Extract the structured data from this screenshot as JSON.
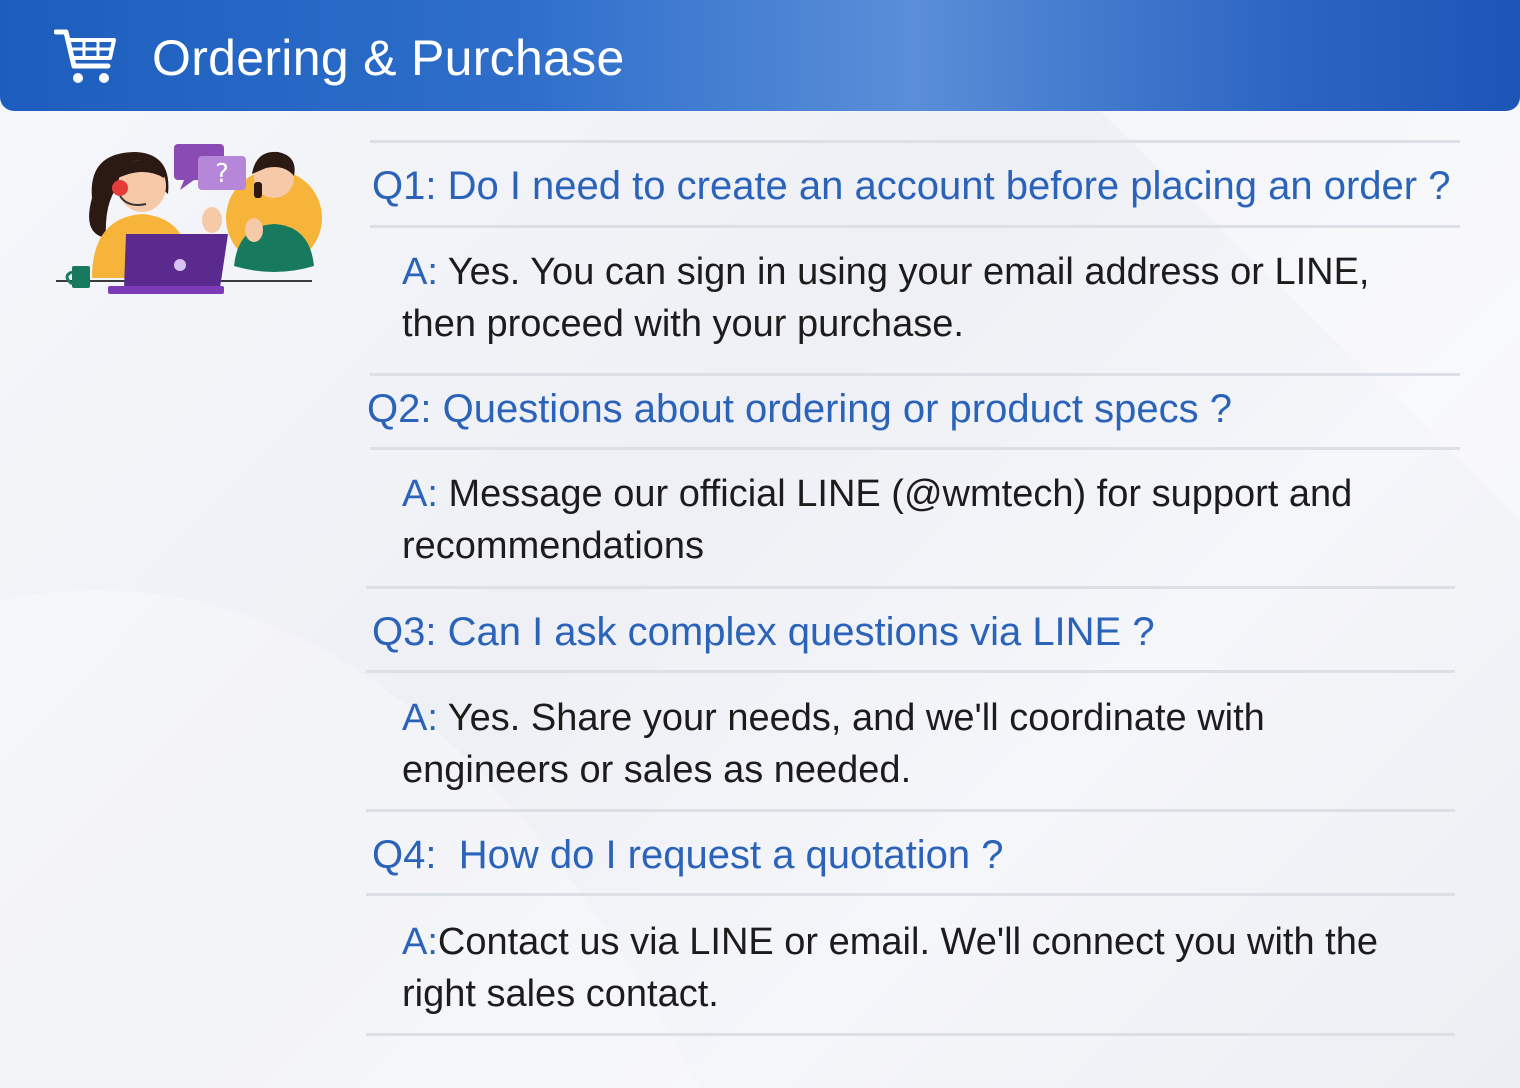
{
  "header": {
    "title": "Ordering & Purchase",
    "icon": "shopping-cart-icon"
  },
  "illustration": {
    "icon": "customer-support-illustration",
    "bubble_glyph": "?"
  },
  "faq": [
    {
      "question": "Q1: Do I need to create an account before placing an order ?",
      "answer_label": "A:",
      "answer_text": " Yes. You can sign in using your email address or LINE, then proceed with your purchase."
    },
    {
      "question": "Q2: Questions about ordering or product specs ?",
      "answer_label": "A:",
      "answer_text": " Message our official LINE (@wmtech) for support and recommendations"
    },
    {
      "question": "Q3: Can I ask complex questions via LINE ?",
      "answer_label": "A:",
      "answer_text": " Yes. Share your needs, and we'll coordinate with engineers or sales as needed."
    },
    {
      "question": "Q4:  How do I request a quotation ?",
      "answer_label": "A:",
      "answer_text": "Contact us via LINE or email. We'll connect you with the right sales contact."
    }
  ],
  "colors": {
    "header_blue": "#1d5dbd",
    "question_blue": "#2a63b9",
    "answer_text": "#1c1c1c",
    "divider": "#dcdfe5"
  }
}
